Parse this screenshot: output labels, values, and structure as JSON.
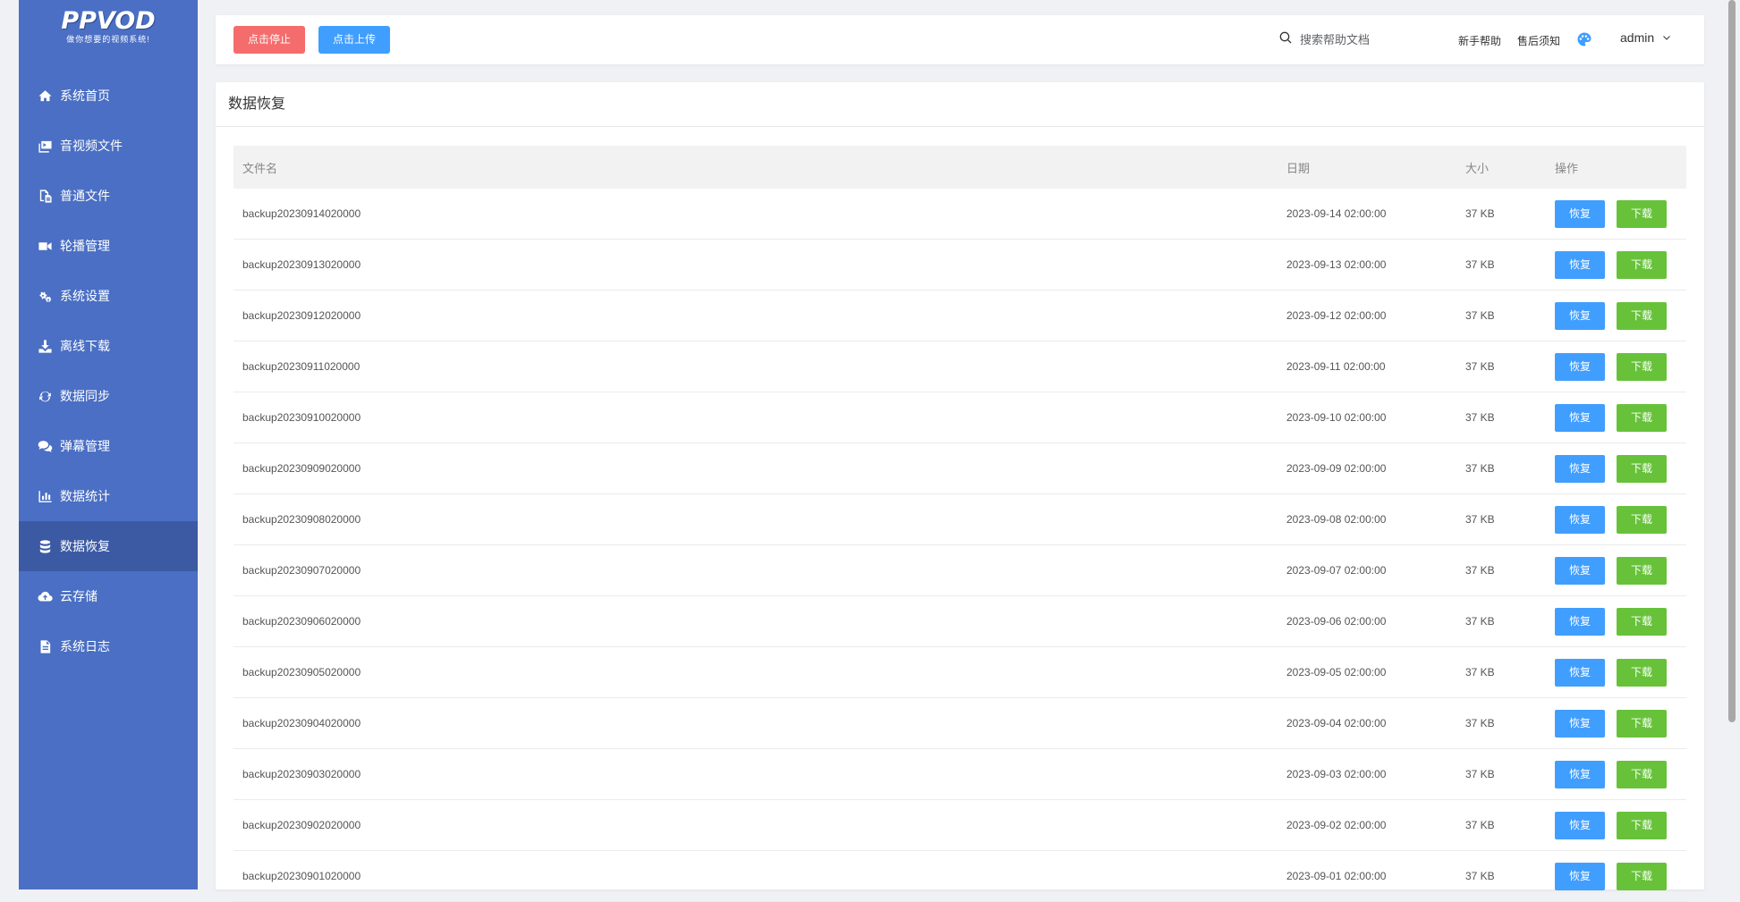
{
  "brand": {
    "logo": "PPVOD",
    "slogan": "做你想要的视频系统!"
  },
  "sidebar": {
    "items": [
      {
        "label": "系统首页",
        "icon": "home-icon"
      },
      {
        "label": "音视频文件",
        "icon": "media-icon"
      },
      {
        "label": "普通文件",
        "icon": "files-icon"
      },
      {
        "label": "轮播管理",
        "icon": "video-camera-icon"
      },
      {
        "label": "系统设置",
        "icon": "gears-icon"
      },
      {
        "label": "离线下载",
        "icon": "download-icon"
      },
      {
        "label": "数据同步",
        "icon": "sync-icon"
      },
      {
        "label": "弹幕管理",
        "icon": "comments-icon"
      },
      {
        "label": "数据统计",
        "icon": "bar-chart-icon"
      },
      {
        "label": "数据恢复",
        "icon": "database-icon",
        "active": true
      },
      {
        "label": "云存储",
        "icon": "cloud-upload-icon"
      },
      {
        "label": "系统日志",
        "icon": "file-text-icon"
      }
    ]
  },
  "topbar": {
    "stop_label": "点击停止",
    "upload_label": "点击上传",
    "search_placeholder": "搜索帮助文档",
    "help_label": "新手帮助",
    "aftersale_label": "售后须知",
    "user_label": "admin"
  },
  "colors": {
    "sidebar_bg": "#4a6fc4",
    "sidebar_active": "#3b5aa3",
    "stop": "#f56c6c",
    "primary": "#409eff",
    "success": "#67c23a"
  },
  "main": {
    "title": "数据恢复",
    "table": {
      "headers": {
        "name": "文件名",
        "date": "日期",
        "size": "大小",
        "action": "操作"
      },
      "restore_label": "恢复",
      "download_label": "下载",
      "rows": [
        {
          "name": "backup20230914020000",
          "date": "2023-09-14 02:00:00",
          "size": "37 KB"
        },
        {
          "name": "backup20230913020000",
          "date": "2023-09-13 02:00:00",
          "size": "37 KB"
        },
        {
          "name": "backup20230912020000",
          "date": "2023-09-12 02:00:00",
          "size": "37 KB"
        },
        {
          "name": "backup20230911020000",
          "date": "2023-09-11 02:00:00",
          "size": "37 KB"
        },
        {
          "name": "backup20230910020000",
          "date": "2023-09-10 02:00:00",
          "size": "37 KB"
        },
        {
          "name": "backup20230909020000",
          "date": "2023-09-09 02:00:00",
          "size": "37 KB"
        },
        {
          "name": "backup20230908020000",
          "date": "2023-09-08 02:00:00",
          "size": "37 KB"
        },
        {
          "name": "backup20230907020000",
          "date": "2023-09-07 02:00:00",
          "size": "37 KB"
        },
        {
          "name": "backup20230906020000",
          "date": "2023-09-06 02:00:00",
          "size": "37 KB"
        },
        {
          "name": "backup20230905020000",
          "date": "2023-09-05 02:00:00",
          "size": "37 KB"
        },
        {
          "name": "backup20230904020000",
          "date": "2023-09-04 02:00:00",
          "size": "37 KB"
        },
        {
          "name": "backup20230903020000",
          "date": "2023-09-03 02:00:00",
          "size": "37 KB"
        },
        {
          "name": "backup20230902020000",
          "date": "2023-09-02 02:00:00",
          "size": "37 KB"
        },
        {
          "name": "backup20230901020000",
          "date": "2023-09-01 02:00:00",
          "size": "37 KB"
        }
      ]
    }
  }
}
